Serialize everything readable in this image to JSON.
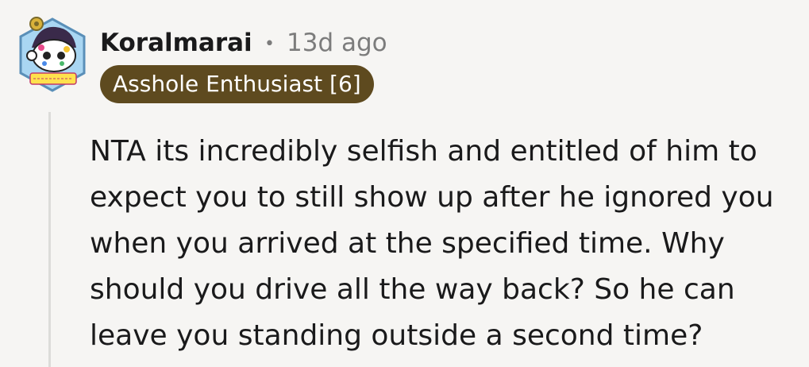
{
  "comment": {
    "author": "Koralmarai",
    "separator": "•",
    "timestamp": "13d ago",
    "flair": "Asshole Enthusiast [6]",
    "avatar": {
      "icon": "snoo-avatar-icon",
      "badge_text": "HAPPY HOLI"
    },
    "body": "NTA its incredibly selfish and entitled of him to expect you to still show up after he ignored you when you arrived at the specified time. Why should you drive all the way back? So he can leave you standing outside a second time?"
  },
  "colors": {
    "background": "#f6f5f3",
    "flair_bg": "#5e4a1f",
    "flair_text": "#ffffff",
    "meta_text": "#7c7c7c",
    "thread_line": "#dcdcd9",
    "avatar_hex": "#a9d6f2"
  }
}
